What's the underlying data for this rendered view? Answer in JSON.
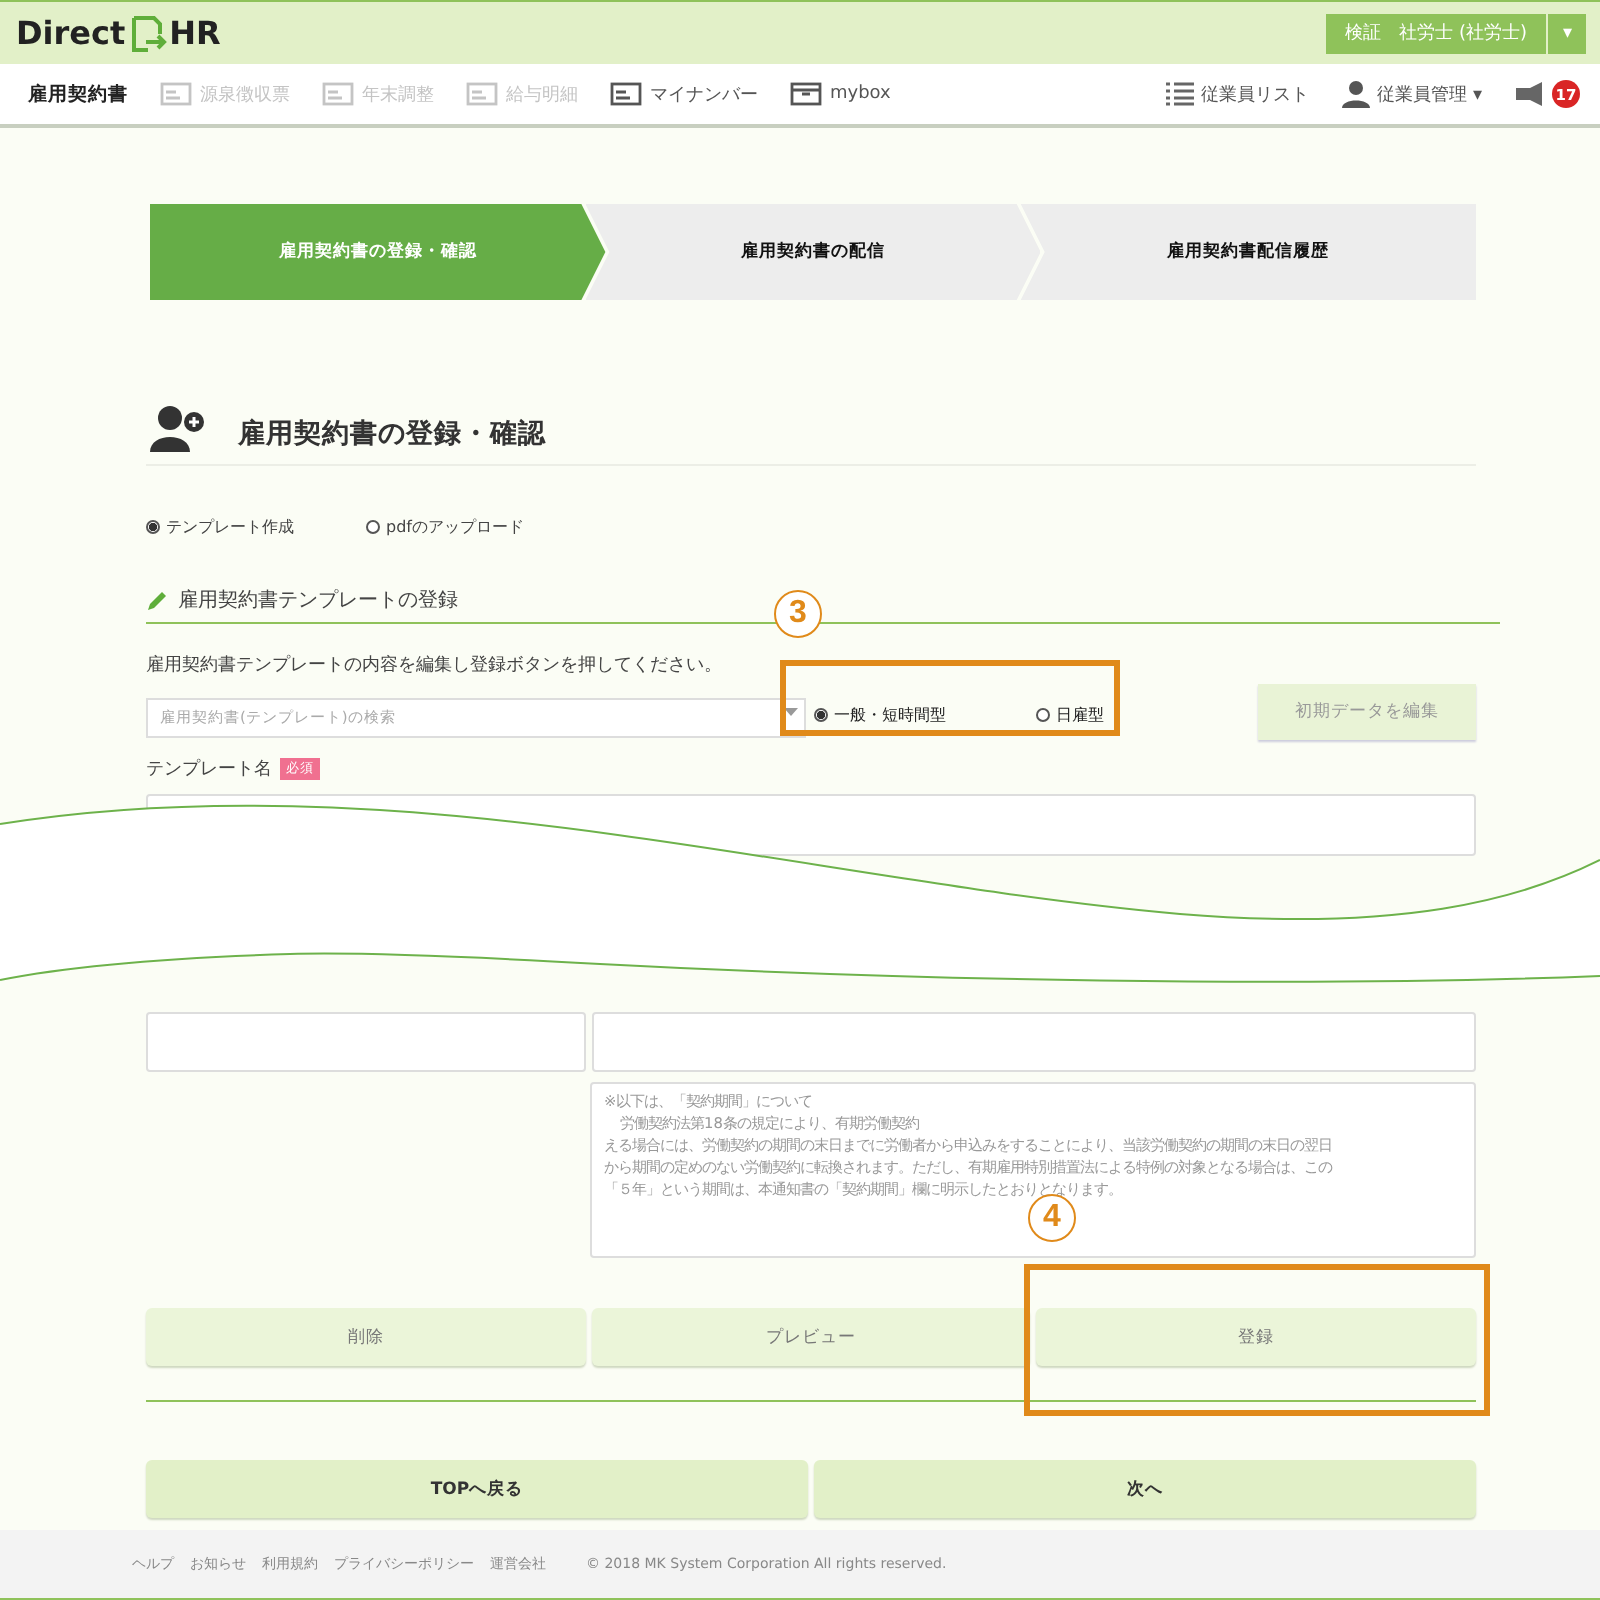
{
  "header": {
    "logo_left": "Direct",
    "logo_right": "HR",
    "user_button": "検証　社労士 (社労士)",
    "menu_caret": "▾"
  },
  "nav": {
    "items": [
      {
        "label": "雇用契約書",
        "selected": true,
        "disabled": false
      },
      {
        "label": "源泉徴収票",
        "selected": false,
        "disabled": true
      },
      {
        "label": "年末調整",
        "selected": false,
        "disabled": true
      },
      {
        "label": "給与明細",
        "selected": false,
        "disabled": true
      },
      {
        "label": "マイナンバー",
        "selected": false,
        "disabled": false
      },
      {
        "label": "mybox",
        "selected": false,
        "disabled": false
      }
    ],
    "right": [
      {
        "label": "従業員リスト"
      },
      {
        "label": "従業員管理",
        "caret": "▾"
      }
    ],
    "badge": "17"
  },
  "steps": [
    {
      "label": "雇用契約書の登録・確認",
      "selected": true
    },
    {
      "label": "雇用契約書の配信",
      "selected": false
    },
    {
      "label": "雇用契約書配信履歴",
      "selected": false
    }
  ],
  "title": "雇用契約書の登録・確認",
  "modes": [
    {
      "label": "テンプレート作成",
      "selected": true
    },
    {
      "label": "pdfのアップロード",
      "selected": false
    }
  ],
  "section_title": "雇用契約書テンプレートの登録",
  "instructions": "雇用契約書テンプレートの内容を編集し登録ボタンを押してください。",
  "search": {
    "placeholder": "雇用契約書(テンプレート)の検索"
  },
  "types": [
    {
      "label": "一般・短時間型",
      "selected": true
    },
    {
      "label": "日雇型",
      "selected": false
    }
  ],
  "edit_button": "初期データを編集",
  "template_name": {
    "label": "テンプレート名",
    "badge": "必須"
  },
  "notice_lines": [
    "※以下は、「契約期間」について",
    "労働契約法第18条の規定により、有期労働契約",
    "える場合には、労働契約の期間の末日までに労働者から申込みをすることにより、当該労働契約の期間の末日の翌日",
    "から期間の定めのない労働契約に転換されます。ただし、有期雇用特別措置法による特例の対象となる場合は、この",
    "「５年」という期間は、本通知書の「契約期間」欄に明示したとおりとなります。"
  ],
  "actions": [
    "削除",
    "プレビュー",
    "登録"
  ],
  "page_buttons": [
    "TOPへ戻る",
    "次へ"
  ],
  "footer": {
    "links": [
      "ヘルプ",
      "お知らせ",
      "利用規約",
      "プライバシーポリシー",
      "運営会社"
    ],
    "copyright": "© 2018 MK System Corporation All rights reserved."
  },
  "annotations": [
    {
      "label": "3"
    },
    {
      "label": "4"
    }
  ]
}
